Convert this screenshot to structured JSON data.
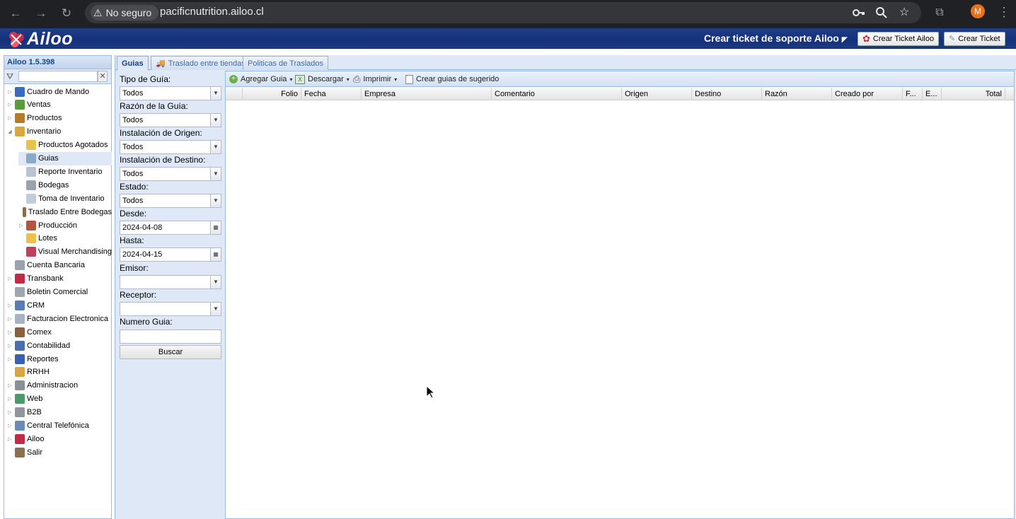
{
  "browser": {
    "security_label": "No seguro",
    "url": "pacificnutrition.ailoo.cl",
    "avatar_initial": "M",
    "icons": [
      "back-icon",
      "forward-icon",
      "reload-icon",
      "warning-icon",
      "key-icon",
      "zoom-icon",
      "star-icon",
      "extensions-icon",
      "menu-icon"
    ]
  },
  "header": {
    "brand": "Ailoo",
    "support_title": "Crear ticket de soporte Ailoo",
    "support_caret": "◤",
    "btn_ticket_ailoo": "Crear Ticket Ailoo",
    "btn_ticket": "Crear Ticket"
  },
  "sidebar": {
    "title": "Ailoo 1.5.398",
    "items": [
      {
        "label": "Cuadro de Mando",
        "expandable": true,
        "icon": "chart-icon"
      },
      {
        "label": "Ventas",
        "expandable": true,
        "icon": "ventas-icon"
      },
      {
        "label": "Productos",
        "expandable": true,
        "icon": "box-icon"
      },
      {
        "label": "Inventario",
        "expandable": true,
        "expanded": true,
        "icon": "package-icon"
      },
      {
        "label": "Productos Agotados",
        "child": true,
        "icon": "folder-icon"
      },
      {
        "label": "Guias",
        "child": true,
        "selected": true,
        "icon": "document-icon"
      },
      {
        "label": "Reporte Inventario",
        "child": true,
        "icon": "report-icon"
      },
      {
        "label": "Bodegas",
        "child": true,
        "icon": "warehouse-icon"
      },
      {
        "label": "Toma de Inventario",
        "child": true,
        "icon": "checklist-icon"
      },
      {
        "label": "Traslado Entre Bodegas",
        "child": true,
        "icon": "truck-icon"
      },
      {
        "label": "Producción",
        "child": true,
        "expandable": true,
        "icon": "factory-icon"
      },
      {
        "label": "Lotes",
        "child": true,
        "icon": "lot-box-icon"
      },
      {
        "label": "Visual Merchandising",
        "child": true,
        "icon": "merch-icon"
      },
      {
        "label": "Cuenta Bancaria",
        "icon": "bank-icon"
      },
      {
        "label": "Transbank",
        "expandable": true,
        "icon": "transbank-icon"
      },
      {
        "label": "Boletin Comercial",
        "icon": "tag-icon"
      },
      {
        "label": "CRM",
        "expandable": true,
        "icon": "crm-icon"
      },
      {
        "label": "Facturacion Electronica",
        "expandable": true,
        "icon": "invoice-icon"
      },
      {
        "label": "Comex",
        "expandable": true,
        "icon": "ship-icon"
      },
      {
        "label": "Contabilidad",
        "expandable": true,
        "icon": "ledger-icon"
      },
      {
        "label": "Reportes",
        "expandable": true,
        "icon": "bars-icon"
      },
      {
        "label": "RRHH",
        "icon": "people-folder-icon"
      },
      {
        "label": "Administracion",
        "expandable": true,
        "icon": "gear-icon"
      },
      {
        "label": "Web",
        "expandable": true,
        "icon": "globe-icon"
      },
      {
        "label": "B2B",
        "expandable": true,
        "icon": "building-icon"
      },
      {
        "label": "Central Telefónica",
        "expandable": true,
        "icon": "phone-icon"
      },
      {
        "label": "Ailoo",
        "expandable": true,
        "icon": "ailoo-icon"
      },
      {
        "label": "Salir",
        "icon": "exit-icon"
      }
    ]
  },
  "tabs": [
    {
      "label": "Guias",
      "active": true
    },
    {
      "label": "Traslado entre tiendas",
      "icon": "truck-icon"
    },
    {
      "label": "Politicas de Traslados"
    }
  ],
  "form": {
    "tipo_label": "Tipo de Guía:",
    "tipo_value": "Todos",
    "razon_label": "Razón de la Guía:",
    "razon_value": "Todos",
    "origen_label": "Instalación de Origen:",
    "origen_value": "Todos",
    "destino_label": "Instalación de Destino:",
    "destino_value": "Todos",
    "estado_label": "Estado:",
    "estado_value": "Todos",
    "desde_label": "Desde:",
    "desde_value": "2024-04-08",
    "hasta_label": "Hasta:",
    "hasta_value": "2024-04-15",
    "emisor_label": "Emisor:",
    "emisor_value": "",
    "receptor_label": "Receptor:",
    "receptor_value": "",
    "numero_label": "Numero Guia:",
    "numero_value": "",
    "buscar_label": "Buscar"
  },
  "toolbar": {
    "agregar": "Agregar Guia",
    "descargar": "Descargar",
    "imprimir": "Imprimir",
    "sugerido": "Crear guias de sugerido"
  },
  "grid": {
    "columns": [
      "Folio",
      "Fecha",
      "Empresa",
      "Comentario",
      "Origen",
      "Destino",
      "Razón",
      "Creado por",
      "F...",
      "E...",
      "Total"
    ]
  }
}
